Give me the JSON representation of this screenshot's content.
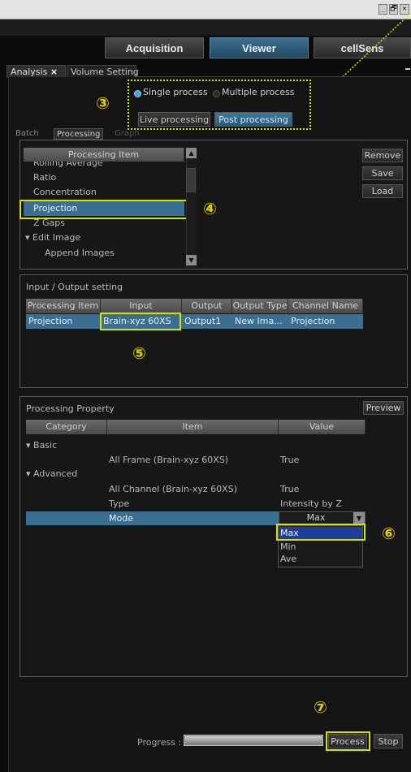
{
  "window": {
    "min_glyph": "_",
    "restore_glyph": "🗗",
    "close_glyph": "✕"
  },
  "nav": {
    "acquisition": "Acquisition",
    "viewer": "Viewer",
    "cellsens": "cellSens"
  },
  "tabs": {
    "analysis": "Analysis",
    "analysis_close": "×",
    "volume_setting": "Volume Setting"
  },
  "mode": {
    "single": "Single process",
    "multiple": "Multiple process",
    "live": "Live processing",
    "post": "Post processing"
  },
  "subtabs": {
    "batch": "Batch",
    "processing": "Processing",
    "graph": "Graph"
  },
  "callouts": {
    "n3": "③",
    "n4": "④",
    "n5": "⑤",
    "n6": "⑥",
    "n7": "⑦"
  },
  "processing_list": {
    "header": "Processing Item",
    "items": [
      "Rolling Average",
      "Ratio",
      "Concentration",
      "Projection",
      "Z Gaps",
      "▾  Edit Image",
      "Append Images"
    ],
    "selected": "Projection",
    "buttons": {
      "remove": "Remove",
      "save": "Save",
      "load": "Load"
    }
  },
  "io_setting": {
    "title": "Input / Output setting",
    "columns": [
      "Processing Item",
      "Input",
      "Output",
      "Output Type",
      "Channel Name"
    ],
    "row": [
      "Projection",
      "Brain-xyz 60XS",
      "Output1",
      "New Ima...",
      "Projection"
    ]
  },
  "property": {
    "title": "Processing Property",
    "preview": "Preview",
    "columns": [
      "Category",
      "Item",
      "Value"
    ],
    "basic": "▾  Basic",
    "advanced": "▾  Advanced",
    "rows": [
      {
        "item": "All Frame (Brain-xyz 60XS)",
        "value": "True"
      },
      {
        "item": "All Channel (Brain-xyz 60XS)",
        "value": "True"
      },
      {
        "item": "Type",
        "value": "Intensity by Z"
      },
      {
        "item": "Mode",
        "value": "Max"
      }
    ],
    "dropdown_options": [
      "Max",
      "Min",
      "Ave"
    ]
  },
  "footer": {
    "progress_label": "Progress :",
    "process": "Process",
    "stop": "Stop"
  }
}
